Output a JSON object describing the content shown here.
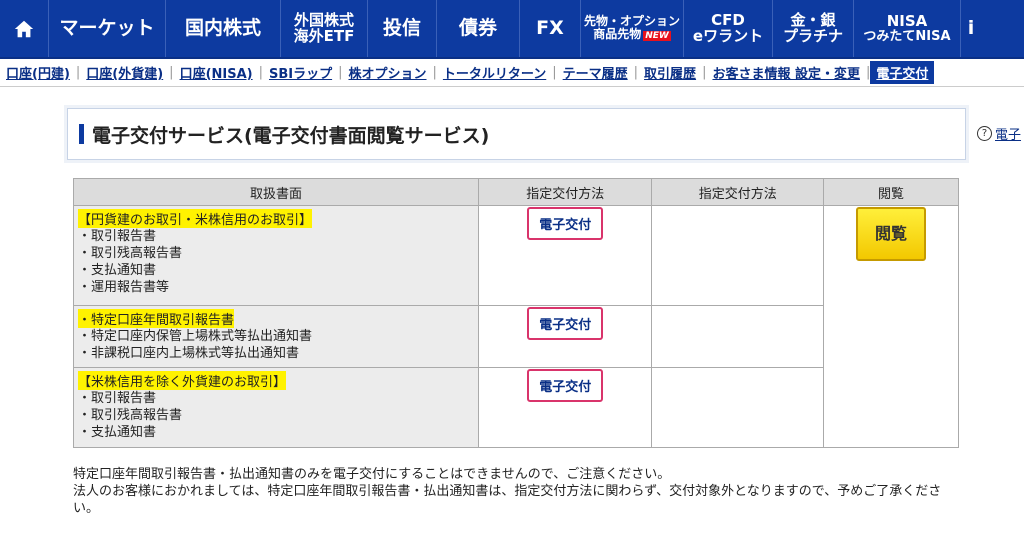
{
  "top_nav": {
    "items": [
      {
        "label": "マーケット"
      },
      {
        "label": "国内株式"
      },
      {
        "line1": "外国株式",
        "line2": "海外ETF"
      },
      {
        "label": "投信"
      },
      {
        "label": "債券"
      },
      {
        "label": "FX"
      },
      {
        "line1": "先物・オプション",
        "line2": "商品先物",
        "badge": "NEW"
      },
      {
        "line1": "CFD",
        "line2": "eワラント"
      },
      {
        "line1": "金・銀",
        "line2": "プラチナ"
      },
      {
        "line1": "NISA",
        "line2": "つみたてNISA"
      },
      {
        "line1": "i"
      }
    ]
  },
  "sub_nav": {
    "items": [
      "口座(円建)",
      "口座(外貨建)",
      "口座(NISA)",
      "SBIラップ",
      "株オプション",
      "トータルリターン",
      "テーマ履歴",
      "取引履歴",
      "お客さま情報 設定・変更",
      "電子交付"
    ]
  },
  "page": {
    "title": "電子交付サービス(電子交付書面閲覧サービス)",
    "help_link": "電子"
  },
  "table": {
    "headers": [
      "取扱書面",
      "指定交付方法",
      "指定交付方法",
      "閲覧"
    ],
    "rows": [
      {
        "group": "【円貨建のお取引・米株信用のお取引】",
        "items": [
          "・取引報告書",
          "・取引残高報告書",
          "・支払通知書",
          "・運用報告書等"
        ],
        "method_button": "電子交付"
      },
      {
        "group": "・特定口座年間取引報告書",
        "items": [
          "・特定口座内保管上場株式等払出通知書",
          "・非課税口座内上場株式等払出通知書"
        ],
        "method_button": "電子交付"
      },
      {
        "group": "【米株信用を除く外貨建のお取引】",
        "items": [
          "・取引報告書",
          "・取引残高報告書",
          "・支払通知書"
        ],
        "method_button": "電子交付"
      }
    ],
    "view_button": "閲覧"
  },
  "notes": {
    "line1": "特定口座年間取引報告書・払出通知書のみを電子交付にすることはできませんので、ご注意ください。",
    "line2": "法人のお客様におかれましては、特定口座年間取引報告書・払出通知書は、指定交付方法に関わらず、交付対象外となりますので、予めご了承ください。"
  }
}
